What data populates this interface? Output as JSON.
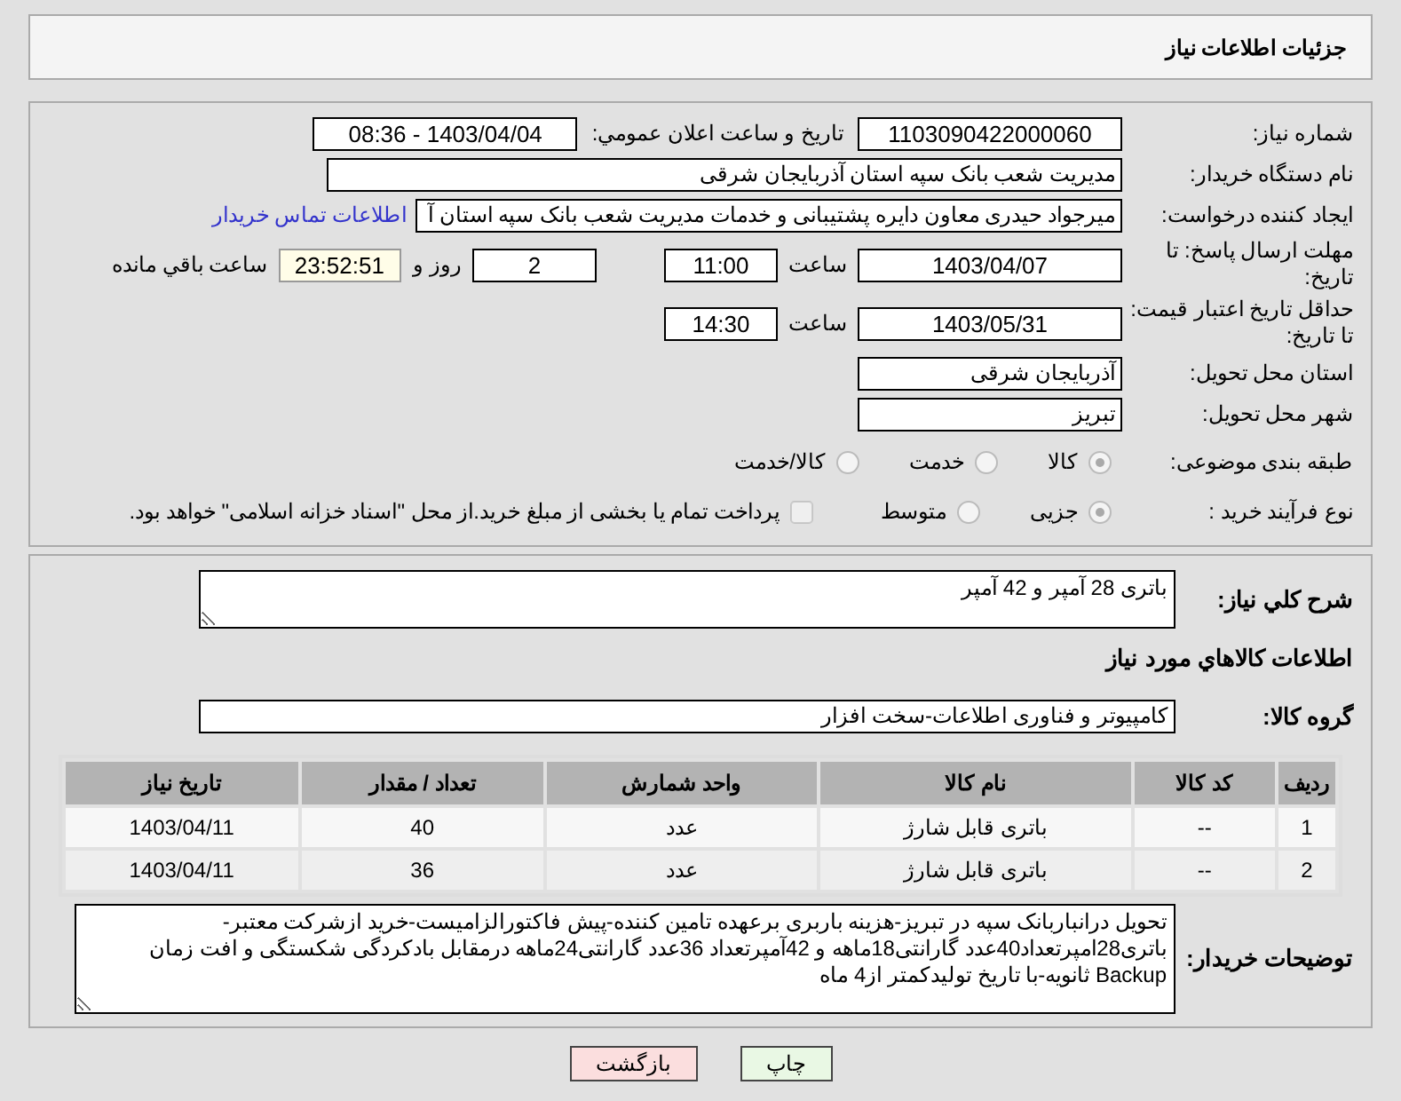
{
  "header": {
    "title": "جزئیات اطلاعات نیاز"
  },
  "details": {
    "need_number": {
      "label": "شماره نیاز:",
      "value": "1103090422000060"
    },
    "announce": {
      "label": "تاریخ و ساعت اعلان عمومي:",
      "value": "1403/04/04 - 08:36"
    },
    "buyer_org": {
      "label": "نام دستگاه خریدار:",
      "value": "مدیریت شعب بانک سپه استان آذربایجان شرقی"
    },
    "requester": {
      "label": "ایجاد کننده درخواست:",
      "value": "میرجواد حیدری معاون دایره پشتیبانی و خدمات مدیریت شعب بانک سپه استان آ",
      "link": "اطلاعات تماس خریدار"
    },
    "deadline": {
      "label": "مهلت ارسال پاسخ: تا تاریخ:",
      "date": "1403/04/07",
      "time_label": "ساعت",
      "time": "11:00",
      "days": "2",
      "days_label": "روز و",
      "remaining": "23:52:51",
      "remaining_label": "ساعت باقي مانده"
    },
    "price_validity": {
      "label": "حداقل تاریخ اعتبار قیمت: تا تاریخ:",
      "date": "1403/05/31",
      "time_label": "ساعت",
      "time": "14:30"
    },
    "province": {
      "label": "استان محل تحویل:",
      "value": "آذربایجان شرقی"
    },
    "city": {
      "label": "شهر محل تحویل:",
      "value": "تبریز"
    },
    "category": {
      "label": "طبقه بندی موضوعی:",
      "options": [
        {
          "label": "کالا",
          "selected": true
        },
        {
          "label": "خدمت",
          "selected": false
        },
        {
          "label": "کالا/خدمت",
          "selected": false
        }
      ]
    },
    "purchase_type": {
      "label": "نوع فرآیند خرید :",
      "options": [
        {
          "label": "جزیی",
          "selected": true
        },
        {
          "label": "متوسط",
          "selected": false
        }
      ],
      "treasury": {
        "label": "پرداخت تمام یا بخشی از مبلغ خرید.از محل \"اسناد خزانه اسلامی\" خواهد بود.",
        "checked": false
      }
    }
  },
  "need": {
    "description": {
      "label": "شرح کلي نیاز:",
      "value": "باتری 28 آمپر و 42 آمپر"
    },
    "section_title": "اطلاعات کالاهاي مورد نیاز",
    "goods_group": {
      "label": "گروه کالا:",
      "value": "کامپیوتر و فناوری اطلاعات-سخت افزار"
    },
    "table": {
      "columns": [
        "ردیف",
        "کد کالا",
        "نام کالا",
        "واحد شمارش",
        "تعداد / مقدار",
        "تاریخ نیاز"
      ],
      "rows": [
        [
          "1",
          "--",
          "باتری قابل شارژ",
          "عدد",
          "40",
          "1403/04/11"
        ],
        [
          "2",
          "--",
          "باتری قابل شارژ",
          "عدد",
          "36",
          "1403/04/11"
        ]
      ]
    },
    "buyer_notes": {
      "label": "توضیحات خریدار:",
      "lines": [
        "تحویل درانباربانک سپه در تبریز-هزینه باربری برعهده تامین کننده-پیش فاکتورالزامیست-خرید ازشرکت معتبر-",
        "باتری28امپرتعداد40عدد گارانتی18ماهه و 42آمپرتعداد 36عدد گارانتی24ماهه درمقابل بادکردگی شکستگی و افت زمان",
        "Backup ثانویه-با تاریخ تولیدکمتر از4 ماه"
      ]
    }
  },
  "buttons": [
    {
      "kind": "print",
      "label": "چاپ"
    },
    {
      "kind": "back",
      "label": "بازگشت"
    }
  ]
}
